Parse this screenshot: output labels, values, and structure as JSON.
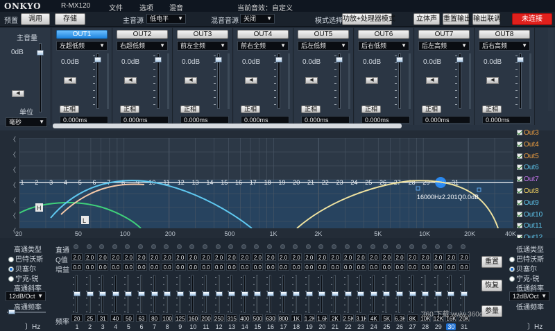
{
  "titlebar": {
    "brand": "ONKYO",
    "model": "R-MX120",
    "menu": [
      "文件",
      "选项",
      "混音"
    ],
    "status_label": "当前音效：自定义"
  },
  "toolbar": {
    "preset": "预置",
    "load": "调用",
    "save": "存储",
    "main_source_label": "主音源",
    "main_source_value": "低电平",
    "mix_source_label": "混音音源",
    "mix_source_value": "关闭",
    "mode_label": "模式选择",
    "mode_value": "功放+处理器模式",
    "stereo": "立体声",
    "reset_output": "重置输出",
    "output_link": "输出联调",
    "connect": "未连接"
  },
  "master": {
    "label": "主音量",
    "db": "0dB",
    "unit_label": "单位",
    "unit_value": "毫秒"
  },
  "channels": [
    {
      "name": "OUT1",
      "filter": "左超低频",
      "gain": "0.0dB",
      "phase": "正相",
      "delay": "0.000ms",
      "active": true
    },
    {
      "name": "OUT2",
      "filter": "右超低频",
      "gain": "0.0dB",
      "phase": "正相",
      "delay": "0.000ms",
      "active": false
    },
    {
      "name": "OUT3",
      "filter": "前左全频",
      "gain": "0.0dB",
      "phase": "正相",
      "delay": "0.000ms",
      "active": false
    },
    {
      "name": "OUT4",
      "filter": "前右全频",
      "gain": "0.0dB",
      "phase": "正相",
      "delay": "0.000ms",
      "active": false
    },
    {
      "name": "OUT5",
      "filter": "后左低频",
      "gain": "0.0dB",
      "phase": "正相",
      "delay": "0.000ms",
      "active": false
    },
    {
      "name": "OUT6",
      "filter": "后右低频",
      "gain": "0.0dB",
      "phase": "正相",
      "delay": "0.000ms",
      "active": false
    },
    {
      "name": "OUT7",
      "filter": "后左高频",
      "gain": "0.0dB",
      "phase": "正相",
      "delay": "0.000ms",
      "active": false
    },
    {
      "name": "OUT8",
      "filter": "后右高频",
      "gain": "0.0dB",
      "phase": "正相",
      "delay": "0.000ms",
      "active": false
    }
  ],
  "graph": {
    "x_ticks": [
      "20",
      "50",
      "100",
      "200",
      "500",
      "1K",
      "2K",
      "5K",
      "10K",
      "20K",
      "40K"
    ],
    "band_markers": [
      "1",
      "2",
      "3",
      "4",
      "5",
      "6",
      "7",
      "8",
      "9",
      "10",
      "11",
      "12",
      "13",
      "14",
      "15",
      "16",
      "17",
      "18",
      "19",
      "20",
      "21",
      "22",
      "23",
      "24",
      "25",
      "26",
      "27",
      "28",
      "29",
      "30",
      "31"
    ],
    "selected_band": "30",
    "point_label": "16000Hz2.201Q0.0dB",
    "h_marker": "H",
    "l_marker": "L",
    "legend": [
      {
        "label": "Out3",
        "color": "#f0a040"
      },
      {
        "label": "Out4",
        "color": "#f0a040"
      },
      {
        "label": "Out5",
        "color": "#f0a040"
      },
      {
        "label": "Out6",
        "color": "#5fc8f0"
      },
      {
        "label": "Out7",
        "color": "#c878f0"
      },
      {
        "label": "Out8",
        "color": "#f0d060"
      },
      {
        "label": "Out9",
        "color": "#5fc8f0"
      },
      {
        "label": "Out10",
        "color": "#5fc8f0"
      },
      {
        "label": "Out11",
        "color": "#5fc8f0"
      },
      {
        "label": "Out12",
        "color": "#5fc8f0"
      }
    ]
  },
  "geq": {
    "hp_type_label": "高通类型",
    "hp_types": [
      "巴特沃斯",
      "贝塞尔",
      "宁克-锐"
    ],
    "hp_selected": 1,
    "hp_slope_label": "高通斜率",
    "hp_slope_value": "12dB/Oct",
    "hp_freq_label": "高通频率",
    "hp_freq_unit": "Hz",
    "row_labels": {
      "bypass": "直通",
      "q": "Q值",
      "gain": "增益",
      "freq": "频率"
    },
    "q_values": [
      "2.0",
      "2.0",
      "2.0",
      "2.0",
      "2.0",
      "2.0",
      "2.0",
      "2.0",
      "2.0",
      "2.0",
      "2.0",
      "2.0",
      "2.0",
      "2.0",
      "2.0",
      "2.0",
      "2.0",
      "2.0",
      "2.0",
      "2.0",
      "2.0",
      "2.0",
      "2.0",
      "2.0",
      "2.0",
      "2.0",
      "2.0",
      "2.0",
      "2.0",
      "2.0",
      "2.0"
    ],
    "gain_values": [
      "0.0",
      "0.0",
      "0.0",
      "0.0",
      "0.0",
      "0.0",
      "0.0",
      "0.0",
      "0.0",
      "0.0",
      "0.0",
      "0.0",
      "0.0",
      "0.0",
      "0.0",
      "0.0",
      "0.0",
      "0.0",
      "0.0",
      "0.0",
      "0.0",
      "0.0",
      "0.0",
      "0.0",
      "0.0",
      "0.0",
      "0.0",
      "0.0",
      "0.0",
      "0.0",
      "0.0"
    ],
    "freq_values": [
      "20",
      "25",
      "31",
      "40",
      "50",
      "63",
      "80",
      "100",
      "125",
      "160",
      "200",
      "250",
      "315",
      "400",
      "500",
      "630",
      "800",
      "1K",
      "1.2K",
      "1.6K",
      "2K",
      "2.5K",
      "3.1K",
      "4K",
      "5K",
      "6.3K",
      "8K",
      "10K",
      "12K",
      "16K",
      "20K"
    ],
    "band_numbers": [
      "1",
      "2",
      "3",
      "4",
      "5",
      "6",
      "7",
      "8",
      "9",
      "10",
      "11",
      "12",
      "13",
      "14",
      "15",
      "16",
      "17",
      "18",
      "19",
      "20",
      "21",
      "22",
      "23",
      "24",
      "25",
      "26",
      "27",
      "28",
      "29",
      "30",
      "31"
    ],
    "reset": "重置",
    "restore": "恢复",
    "params": "参量",
    "lp_type_label": "低通类型",
    "lp_types": [
      "巴特沃斯",
      "贝塞尔",
      "宁克-锐"
    ],
    "lp_selected": 1,
    "lp_slope_label": "低通斜率",
    "lp_slope_value": "12dB/Oct",
    "lp_freq_label": "低通频率",
    "lp_freq_unit": "Hz"
  },
  "watermark": "360 下载  www.360dc.com"
}
